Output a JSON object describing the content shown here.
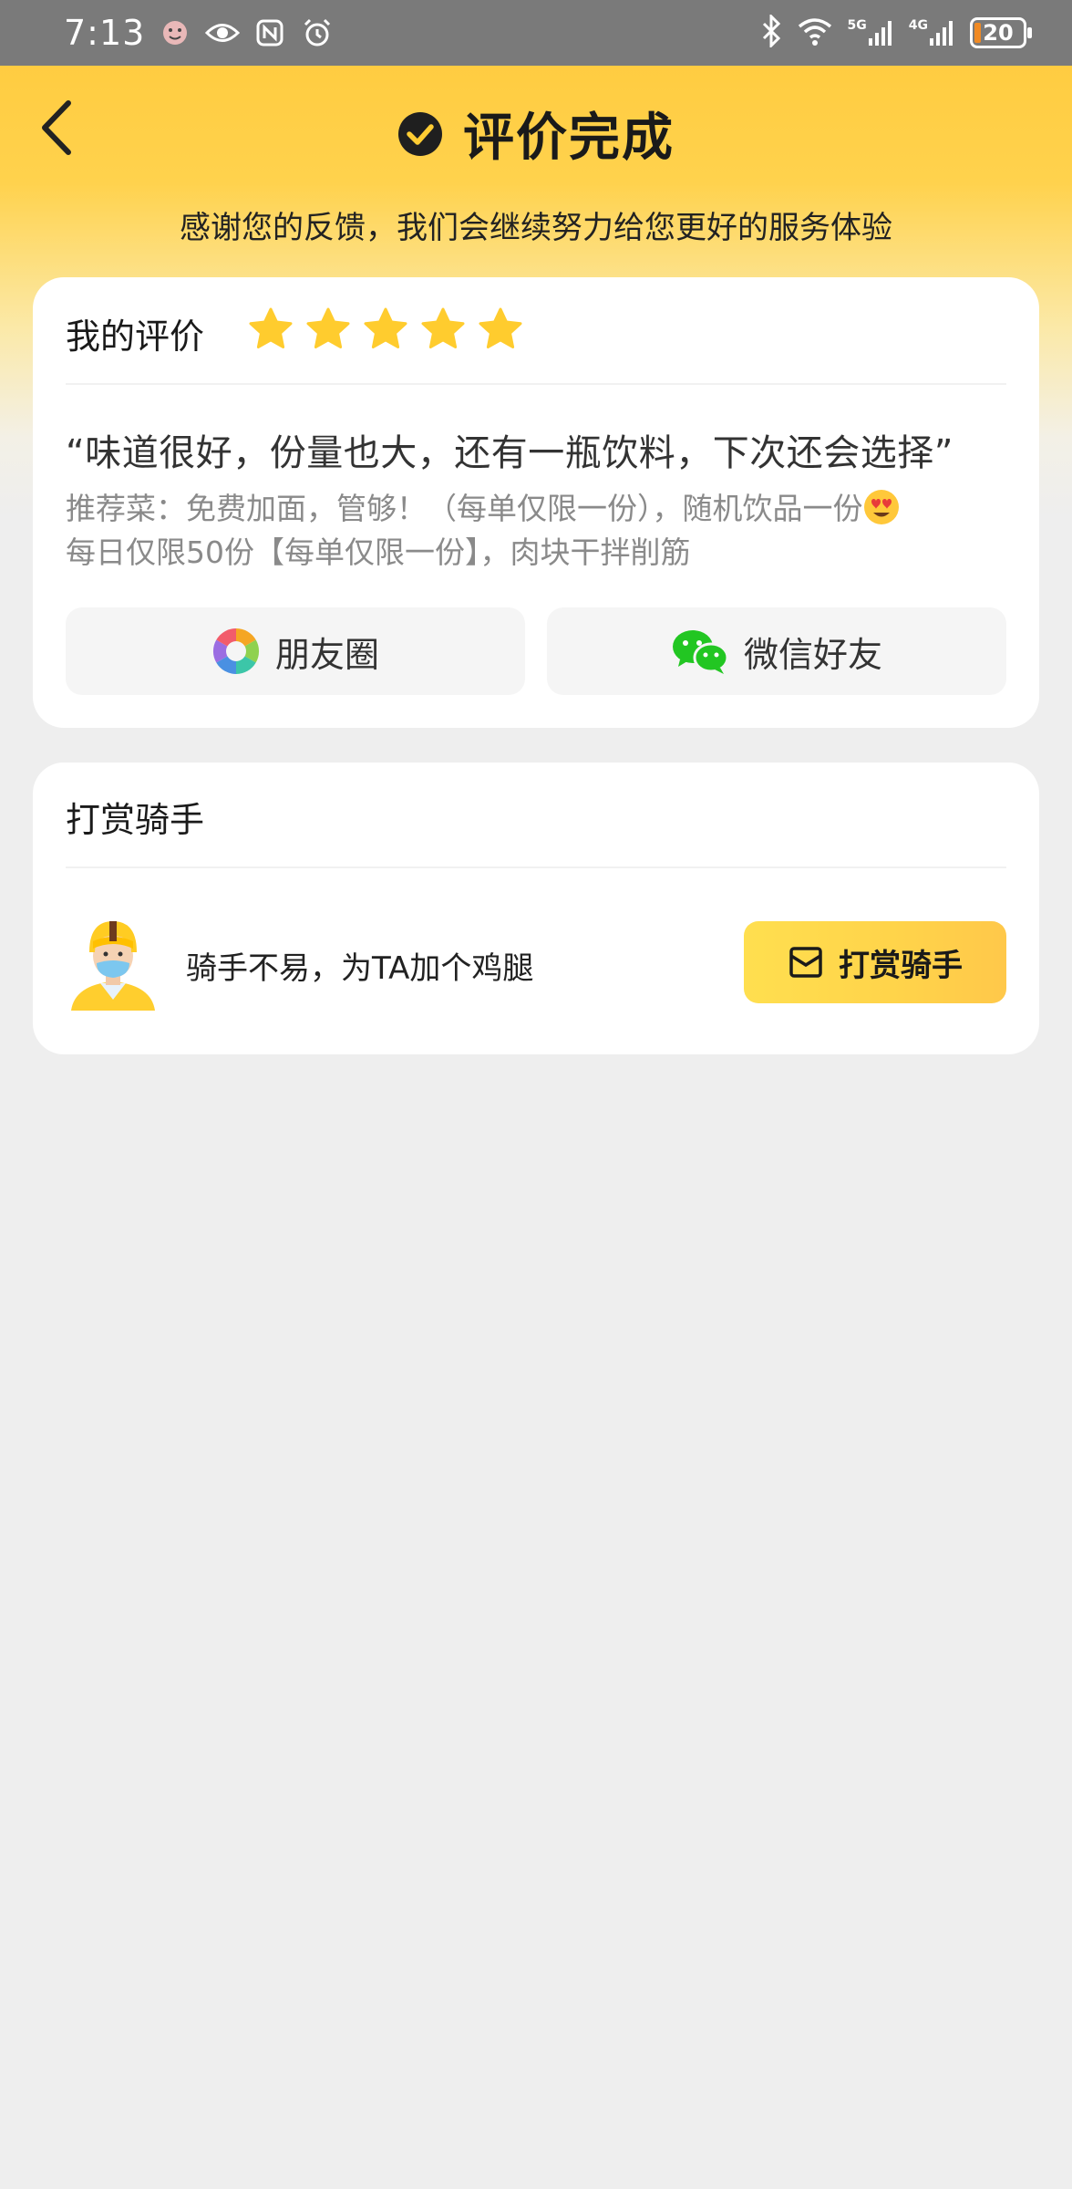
{
  "status_bar": {
    "time": "7:13",
    "battery": "20",
    "network_1": "5G",
    "network_2": "4G"
  },
  "header": {
    "title": "评价完成",
    "subtitle": "感谢您的反馈，我们会继续努力给您更好的服务体验"
  },
  "review": {
    "label": "我的评价",
    "rating": 5,
    "quote": "“味道很好，份量也大，还有一瓶饮料，下次还会选择”",
    "dishes_line1": " 推荐菜：免费加面，管够！（每单仅限一份），随机饮品一份",
    "dishes_line2": "每日仅限50份【每单仅限一份】，肉块干拌削筋"
  },
  "share": {
    "moments_label": "朋友圈",
    "wechat_label": "微信好友"
  },
  "tip": {
    "title": "打赏骑手",
    "message": "骑手不易，为TA加个鸡腿",
    "button_label": "打赏骑手"
  },
  "colors": {
    "brand_yellow": "#ffc93a",
    "star": "#ffcc2e",
    "page_bg": "#eeeeee"
  },
  "icons": [
    "back-icon",
    "check-icon",
    "star-icon",
    "moments-icon",
    "wechat-icon",
    "rider-avatar",
    "envelope-icon",
    "heart-eyes-emoji"
  ]
}
